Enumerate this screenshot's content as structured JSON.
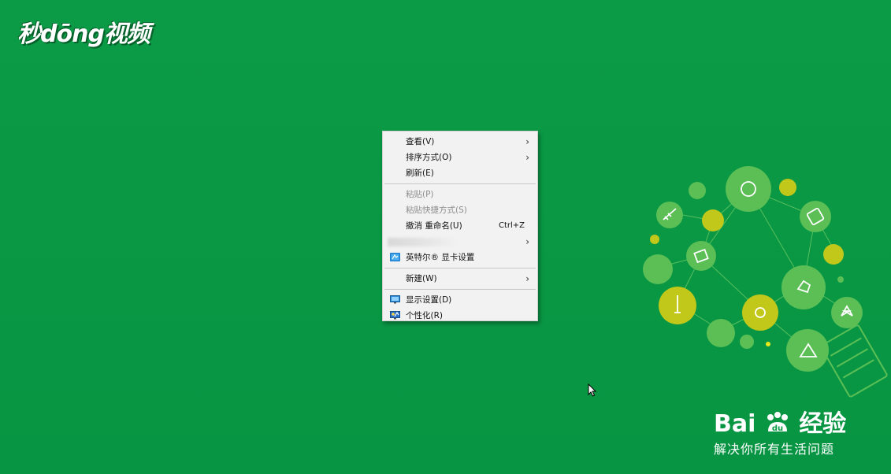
{
  "watermark": {
    "brand": "秒dōng视频"
  },
  "context_menu": {
    "items": [
      {
        "label": "查看(V)",
        "submenu": true,
        "disabled": false
      },
      {
        "label": "排序方式(O)",
        "submenu": true,
        "disabled": false
      },
      {
        "label": "刷新(E)",
        "submenu": false,
        "disabled": false
      },
      {
        "label": "粘贴(P)",
        "submenu": false,
        "disabled": true
      },
      {
        "label": "粘贴快捷方式(S)",
        "submenu": false,
        "disabled": true
      },
      {
        "label": "撤消 重命名(U)",
        "shortcut": "Ctrl+Z",
        "submenu": false,
        "disabled": false
      },
      {
        "label": "",
        "submenu": true,
        "disabled": false,
        "blurred": true
      },
      {
        "label": "英特尔® 显卡设置",
        "icon": "intel-graphics-icon",
        "submenu": false,
        "disabled": false
      },
      {
        "label": "新建(W)",
        "submenu": true,
        "disabled": false
      },
      {
        "label": "显示设置(D)",
        "icon": "display-icon",
        "submenu": false,
        "disabled": false
      },
      {
        "label": "个性化(R)",
        "icon": "personalize-icon",
        "submenu": false,
        "disabled": false
      }
    ],
    "arrow_glyph": "›"
  },
  "baidu": {
    "brand": "Bai经验",
    "brand_prefix": "Bai",
    "brand_suffix": "经验",
    "slogan": "解决你所有生活问题"
  },
  "colors": {
    "desktop_bg": "#0a9a44",
    "menu_bg": "#f2f2f2",
    "illustration_light": "#63c35a",
    "illustration_yellow": "#bfc61a"
  }
}
